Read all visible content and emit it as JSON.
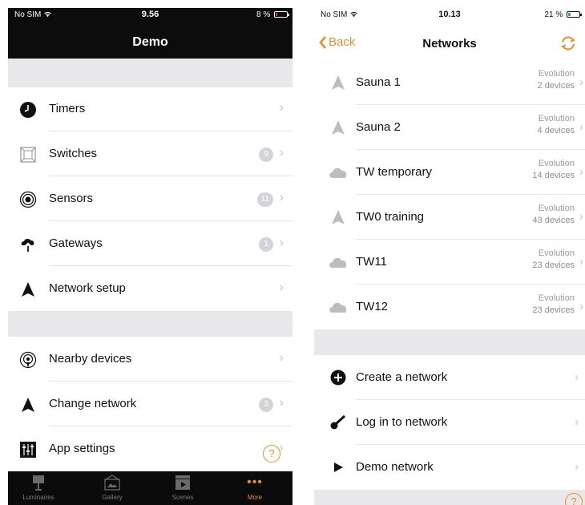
{
  "left": {
    "status": {
      "carrier": "No SIM",
      "time": "9.56",
      "battery": "8 %"
    },
    "title": "Demo",
    "menu": [
      {
        "label": "Timers",
        "icon": "clock-icon",
        "badge": ""
      },
      {
        "label": "Switches",
        "icon": "switch-icon",
        "badge": "9"
      },
      {
        "label": "Sensors",
        "icon": "sensor-icon",
        "badge": "11"
      },
      {
        "label": "Gateways",
        "icon": "gateway-icon",
        "badge": "1"
      },
      {
        "label": "Network setup",
        "icon": "network-setup-icon",
        "badge": ""
      }
    ],
    "menu2": [
      {
        "label": "Nearby devices",
        "icon": "nearby-devices-icon",
        "badge": ""
      },
      {
        "label": "Change network",
        "icon": "change-network-icon",
        "badge": "3"
      },
      {
        "label": "App settings",
        "icon": "app-settings-icon",
        "badge": ""
      }
    ],
    "help": "?",
    "tabs": [
      {
        "label": "Luminaires",
        "icon": "luminaire-icon",
        "active": false
      },
      {
        "label": "Gallery",
        "icon": "gallery-icon",
        "active": false
      },
      {
        "label": "Scenes",
        "icon": "scenes-icon",
        "active": false
      },
      {
        "label": "More",
        "icon": "more-icon",
        "active": true
      }
    ]
  },
  "right": {
    "status": {
      "carrier": "No SIM",
      "time": "10.13",
      "battery": "21 %"
    },
    "back": "Back",
    "title": "Networks",
    "networks": [
      {
        "name": "Sauna 1",
        "type": "Evolution",
        "devices": "2 devices",
        "icon": "triangle-network-icon"
      },
      {
        "name": "Sauna 2",
        "type": "Evolution",
        "devices": "4 devices",
        "icon": "triangle-network-icon"
      },
      {
        "name": "TW temporary",
        "type": "Evolution",
        "devices": "14 devices",
        "icon": "cloud-network-icon"
      },
      {
        "name": "TW0 training",
        "type": "Evolution",
        "devices": "43 devices",
        "icon": "triangle-network-icon"
      },
      {
        "name": "TW11",
        "type": "Evolution",
        "devices": "23 devices",
        "icon": "cloud-network-icon"
      },
      {
        "name": "TW12",
        "type": "Evolution",
        "devices": "23 devices",
        "icon": "cloud-network-icon"
      }
    ],
    "actions": [
      {
        "label": "Create a network",
        "icon": "plus-circle-icon"
      },
      {
        "label": "Log in to network",
        "icon": "key-icon"
      },
      {
        "label": "Demo network",
        "icon": "play-icon"
      }
    ],
    "help": "?"
  },
  "colors": {
    "accent": "#e58e2c",
    "nav_dark": "#0c0c0c",
    "group_gap": "#e8e8ea"
  }
}
